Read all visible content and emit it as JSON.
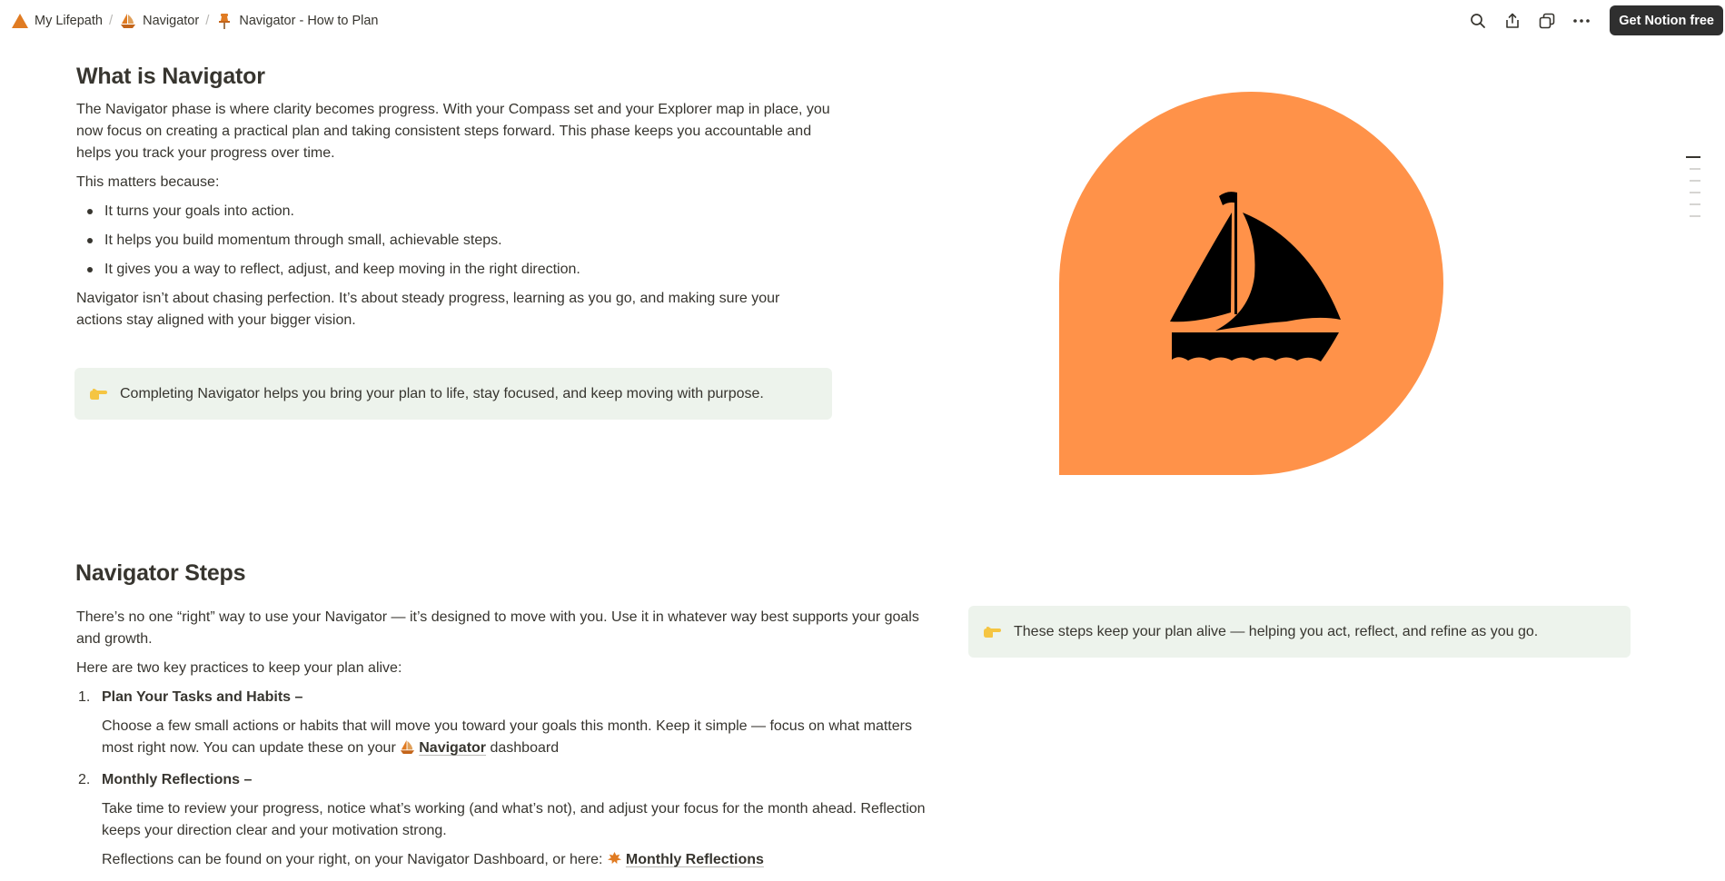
{
  "breadcrumb": [
    {
      "label": "My Lifepath",
      "icon": "warning-triangle-icon"
    },
    {
      "label": "Navigator",
      "icon": "sailboat-icon"
    },
    {
      "label": "Navigator - How to Plan",
      "icon": "pushpin-icon"
    }
  ],
  "toolbar": {
    "get_notion_label": "Get Notion free"
  },
  "section1": {
    "title": "What is Navigator",
    "intro": "The Navigator phase is where clarity becomes progress. With your Compass set and your Explorer map in place, you now focus on creating a practical plan and taking consistent steps forward. This phase keeps you accountable and helps you track your progress over time.",
    "matters": "This matters because:",
    "bullets": [
      "It turns your goals into action.",
      "It helps you build momentum through small, achievable steps.",
      "It gives you a way to reflect, adjust, and keep moving in the right direction."
    ],
    "closing": "Navigator isn’t about chasing perfection. It’s about steady progress, learning as you go, and making sure your actions stay aligned with your bigger vision.",
    "callout": "Completing Navigator helps you bring your plan to life, stay focused, and keep moving with purpose."
  },
  "section2": {
    "title": "Navigator Steps",
    "intro": "There’s no one “right” way to use your Navigator — it’s designed to move with you. Use it in whatever way best supports your goals and growth.",
    "practices": "Here are two key practices to keep your plan alive:",
    "callout": "These steps keep your plan alive — helping you act, reflect, and refine as you go.",
    "steps": [
      {
        "num": "1.",
        "title": "Plan Your Tasks and Habits –",
        "body": "Choose a few small actions or habits that will move you toward your goals this month. Keep it simple — focus on what matters most right now. You can update these on your",
        "link": "Navigator",
        "after": "dashboard"
      },
      {
        "num": "2.",
        "title": "Monthly Reflections –",
        "body": "Take time to review your progress, notice what’s working (and what’s not), and adjust your focus for the month ahead. Reflection keeps your direction clear and your motivation strong.",
        "extra": "Reflections can be found on your right, on your Navigator Dashboard, or here:",
        "extra_link": "Monthly Reflections"
      }
    ]
  },
  "colors": {
    "accent": "#ff9249",
    "callout_bg": "#edf3ec",
    "text": "#37352f"
  }
}
